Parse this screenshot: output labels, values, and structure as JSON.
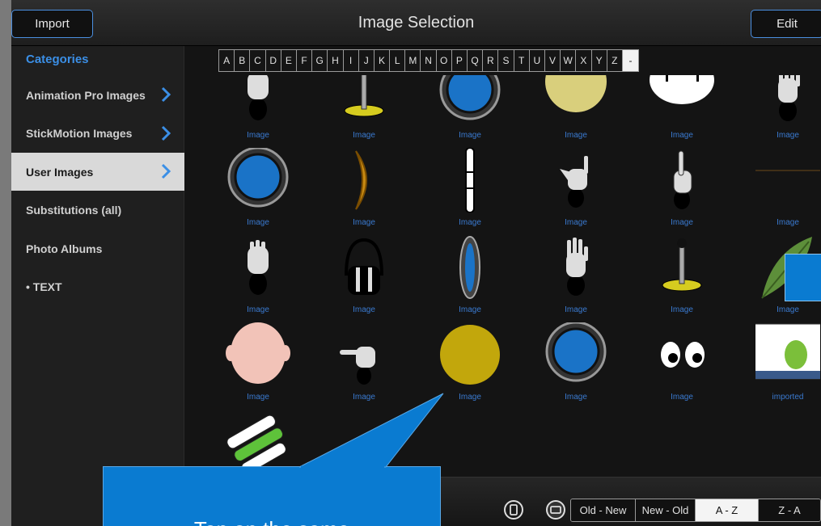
{
  "topbar": {
    "import_label": "Import",
    "title": "Image Selection",
    "edit_label": "Edit"
  },
  "sidebar": {
    "header": "Categories",
    "items": [
      {
        "label": "Animation Pro Images",
        "has_chevron": true,
        "selected": false
      },
      {
        "label": "StickMotion Images",
        "has_chevron": true,
        "selected": false
      },
      {
        "label": "User Images",
        "has_chevron": true,
        "selected": true
      },
      {
        "label": "Substitutions (all)",
        "has_chevron": false,
        "selected": false
      },
      {
        "label": "Photo Albums",
        "has_chevron": false,
        "selected": false
      },
      {
        "label": "• TEXT",
        "has_chevron": false,
        "selected": false
      }
    ]
  },
  "alphabet": {
    "letters": [
      "A",
      "B",
      "C",
      "D",
      "E",
      "F",
      "G",
      "H",
      "I",
      "J",
      "K",
      "L",
      "M",
      "N",
      "O",
      "P",
      "Q",
      "R",
      "S",
      "T",
      "U",
      "V",
      "W",
      "X",
      "Y",
      "Z",
      "-"
    ],
    "active": "-"
  },
  "grid": {
    "items": [
      {
        "caption": "Image",
        "icon": "hand-fist-icon"
      },
      {
        "caption": "Image",
        "icon": "joystick-icon"
      },
      {
        "caption": "Image",
        "icon": "blue-lens-icon"
      },
      {
        "caption": "Image",
        "icon": "yellow-circle-icon"
      },
      {
        "caption": "Image",
        "icon": "white-face-icon"
      },
      {
        "caption": "Image",
        "icon": "hand-open-icon"
      },
      {
        "caption": "Image",
        "icon": "blue-lens-icon"
      },
      {
        "caption": "Image",
        "icon": "orange-lens-side-icon"
      },
      {
        "caption": "Image",
        "icon": "stick-bar-icon"
      },
      {
        "caption": "Image",
        "icon": "hand-rock-icon"
      },
      {
        "caption": "Image",
        "icon": "hand-point-icon"
      },
      {
        "caption": "Image",
        "icon": "thin-line-icon"
      },
      {
        "caption": "Image",
        "icon": "hand-fist-icon"
      },
      {
        "caption": "Image",
        "icon": "headphones-icon"
      },
      {
        "caption": "Image",
        "icon": "blue-lens-side-icon"
      },
      {
        "caption": "Image",
        "icon": "hand-open-icon"
      },
      {
        "caption": "Image",
        "icon": "joystick-icon"
      },
      {
        "caption": "Image",
        "icon": "leaf-icon"
      },
      {
        "caption": "Image",
        "icon": "bald-head-icon"
      },
      {
        "caption": "Image",
        "icon": "hand-point-side-icon"
      },
      {
        "caption": "Image",
        "icon": "gold-ball-icon"
      },
      {
        "caption": "Image",
        "icon": "blue-lens-icon"
      },
      {
        "caption": "Image",
        "icon": "eyes-icon"
      },
      {
        "caption": "imported",
        "icon": "screenshot-thumb-icon"
      },
      {
        "caption": "",
        "icon": "green-hand-icon"
      }
    ]
  },
  "sort": {
    "options": [
      "Old - New",
      "New - Old",
      "A - Z",
      "Z - A"
    ],
    "selected": "A - Z"
  },
  "bottom_icons": [
    "rotate-icon",
    "swap-icon"
  ],
  "callout": {
    "text": "Tap on the same"
  },
  "colors": {
    "accent": "#3b8fe6",
    "callout": "#0a7bd1"
  }
}
